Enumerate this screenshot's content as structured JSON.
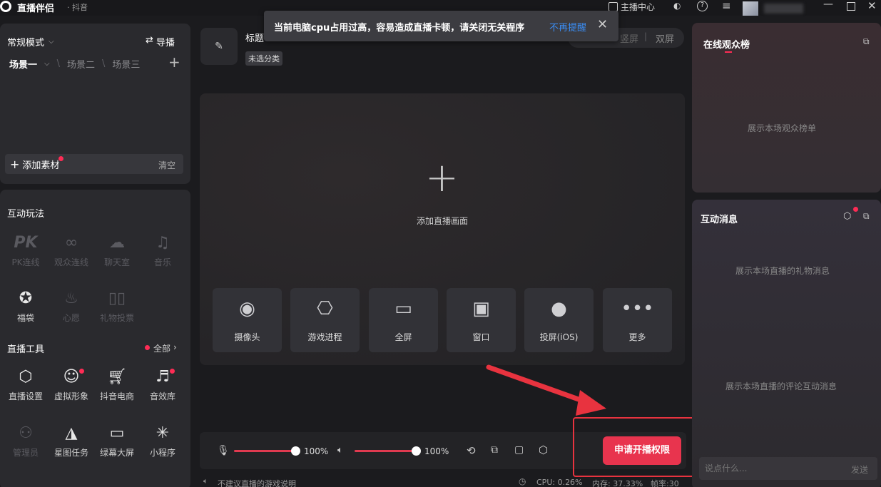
{
  "app": {
    "title": "直播伴侣",
    "subtitle": "· 抖音"
  },
  "topbar": {
    "anchor_center": "主播中心"
  },
  "toast": {
    "message": "当前电脑cpu占用过高，容易造成直播卡顿，请关闭无关程序",
    "dismiss_link": "不再提醒"
  },
  "left": {
    "mode": "常规模式",
    "guide": "导播",
    "scenes": [
      "场景一",
      "场景二",
      "场景三"
    ],
    "add_material": "添加素材",
    "clear": "清空",
    "interactive_title": "互动玩法",
    "interactive": [
      {
        "label": "PK连线",
        "icon": "pk-icon",
        "enabled": false
      },
      {
        "label": "观众连线",
        "icon": "link-icon",
        "enabled": false
      },
      {
        "label": "聊天室",
        "icon": "chatroom-icon",
        "enabled": false
      },
      {
        "label": "音乐",
        "icon": "music-icon",
        "enabled": false
      },
      {
        "label": "福袋",
        "icon": "lucky-bag-icon",
        "enabled": true
      },
      {
        "label": "心愿",
        "icon": "wish-icon",
        "enabled": false
      },
      {
        "label": "礼物投票",
        "icon": "vote-icon",
        "enabled": false
      }
    ],
    "tools_title": "直播工具",
    "tools_all": "全部",
    "tools": [
      {
        "label": "直播设置",
        "icon": "settings-icon",
        "enabled": true
      },
      {
        "label": "虚拟形象",
        "icon": "avatar-icon",
        "enabled": true
      },
      {
        "label": "抖音电商",
        "icon": "cart-icon",
        "enabled": true
      },
      {
        "label": "音效库",
        "icon": "sound-fx-icon",
        "enabled": true
      },
      {
        "label": "管理员",
        "icon": "admin-icon",
        "enabled": false
      },
      {
        "label": "星图任务",
        "icon": "star-task-icon",
        "enabled": true
      },
      {
        "label": "绿幕大屏",
        "icon": "green-screen-icon",
        "enabled": true
      },
      {
        "label": "小程序",
        "icon": "mini-program-icon",
        "enabled": true
      }
    ]
  },
  "center": {
    "title_label": "标题",
    "category_tag": "未选分类",
    "layout_tabs": [
      "竖屏",
      "双屏"
    ],
    "add_source": "添加直播画面",
    "sources": [
      {
        "label": "摄像头",
        "icon": "camera-icon"
      },
      {
        "label": "游戏进程",
        "icon": "gamepad-icon"
      },
      {
        "label": "全屏",
        "icon": "monitor-icon"
      },
      {
        "label": "窗口",
        "icon": "window-icon"
      },
      {
        "label": "投屏(iOS)",
        "icon": "apple-icon"
      },
      {
        "label": "更多",
        "icon": "more-icon"
      }
    ],
    "mic_volume": "100%",
    "speaker_volume": "100%",
    "go_live_button": "申请开播权限",
    "footer_note": "不建议直播的游戏说明",
    "stats": {
      "cpu": "CPU: 0.26%",
      "mem": "内存: 37.33%",
      "fps": "帧率:30"
    }
  },
  "right": {
    "audience_title": "在线观众榜",
    "audience_empty": "展示本场观众榜单",
    "messages_title": "互动消息",
    "gift_empty": "展示本场直播的礼物消息",
    "comment_empty": "展示本场直播的评论互动消息",
    "chat_placeholder": "说点什么...",
    "send": "发送"
  },
  "colors": {
    "accent": "#fe2c55",
    "annotation": "#e8333f",
    "link": "#3a8ef6"
  }
}
